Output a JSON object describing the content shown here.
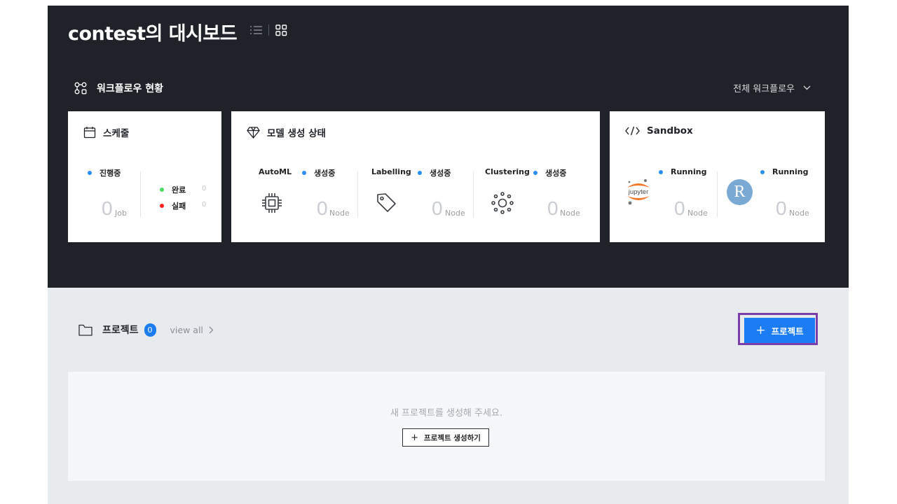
{
  "page": {
    "title": "contest의 대시보드"
  },
  "workflow": {
    "header": "워크플로우 현황",
    "filter_label": "전체 워크플로우",
    "schedule": {
      "title": "스케줄",
      "status_label": "진행중",
      "count": "0",
      "unit": "Job",
      "legend": [
        {
          "label": "완료",
          "value": "0",
          "color": "#4cd964"
        },
        {
          "label": "실패",
          "value": "0",
          "color": "#ff1e1e"
        }
      ]
    },
    "model": {
      "title": "모델 생성 상태",
      "items": [
        {
          "name": "AutoML",
          "status": "생성중",
          "count": "0",
          "unit": "Node",
          "icon": "chip-icon"
        },
        {
          "name": "Labelling",
          "status": "생성중",
          "count": "0",
          "unit": "Node",
          "icon": "tag-icon"
        },
        {
          "name": "Clustering",
          "status": "생성중",
          "count": "0",
          "unit": "Node",
          "icon": "cluster-icon"
        }
      ]
    },
    "sandbox": {
      "title": "Sandbox",
      "items": [
        {
          "logo": "jupyter",
          "logo_text": "jupyter",
          "status": "Running",
          "count": "0",
          "unit": "Node"
        },
        {
          "logo": "r",
          "logo_text": "R",
          "status": "Running",
          "count": "0",
          "unit": "Node"
        }
      ]
    }
  },
  "project": {
    "title": "프로젝트",
    "count": "0",
    "view_all": "view all",
    "add_label": "프로젝트",
    "empty_message": "새 프로젝트를 생성해 주세요.",
    "create_label": "프로젝트 생성하기"
  },
  "colors": {
    "accent": "#1b7cf3",
    "dark_bg": "#1f2228",
    "status_blue": "#2b8ef0",
    "highlight": "#7b3ea8"
  }
}
